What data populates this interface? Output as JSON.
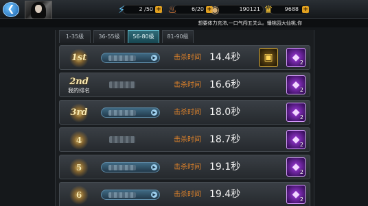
{
  "header": {
    "back_icon": "back-arrow-icon",
    "stamina": {
      "icon": "lightning-icon",
      "value": "2 /50"
    },
    "energy": {
      "icon": "flame-icon",
      "value": "6/20"
    },
    "coins": {
      "icon": "coin-icon",
      "value": "190121"
    },
    "gold": {
      "icon": "crown-icon",
      "value": "9688"
    },
    "marquee": "想要体力充沛,一口气闯五关么。蟠桃园大仙桃,你"
  },
  "tabs": [
    {
      "label": "1-35级",
      "active": false
    },
    {
      "label": "36-55级",
      "active": false
    },
    {
      "label": "56-80级",
      "active": true
    },
    {
      "label": "81-90级",
      "active": false
    }
  ],
  "kill_label": "击杀时间",
  "my_rank_label": "我的排名",
  "rows": [
    {
      "rank": "1st",
      "time": "14.4秒",
      "chest": true,
      "gem_count": "2"
    },
    {
      "rank": "2nd",
      "time": "16.6秒",
      "chest": false,
      "gem_count": "2"
    },
    {
      "rank": "3rd",
      "time": "18.0秒",
      "chest": false,
      "gem_count": "2"
    },
    {
      "rank": "4",
      "time": "18.7秒",
      "chest": false,
      "gem_count": "2"
    },
    {
      "rank": "5",
      "time": "19.1秒",
      "chest": false,
      "gem_count": "2"
    },
    {
      "rank": "6",
      "time": "19.4秒",
      "chest": false,
      "gem_count": "2"
    }
  ],
  "colors": {
    "accent_orange": "#e0832a",
    "tab_active": "#2f6b78",
    "gem": "#a23ce0",
    "chest_gold": "#d9b040"
  }
}
